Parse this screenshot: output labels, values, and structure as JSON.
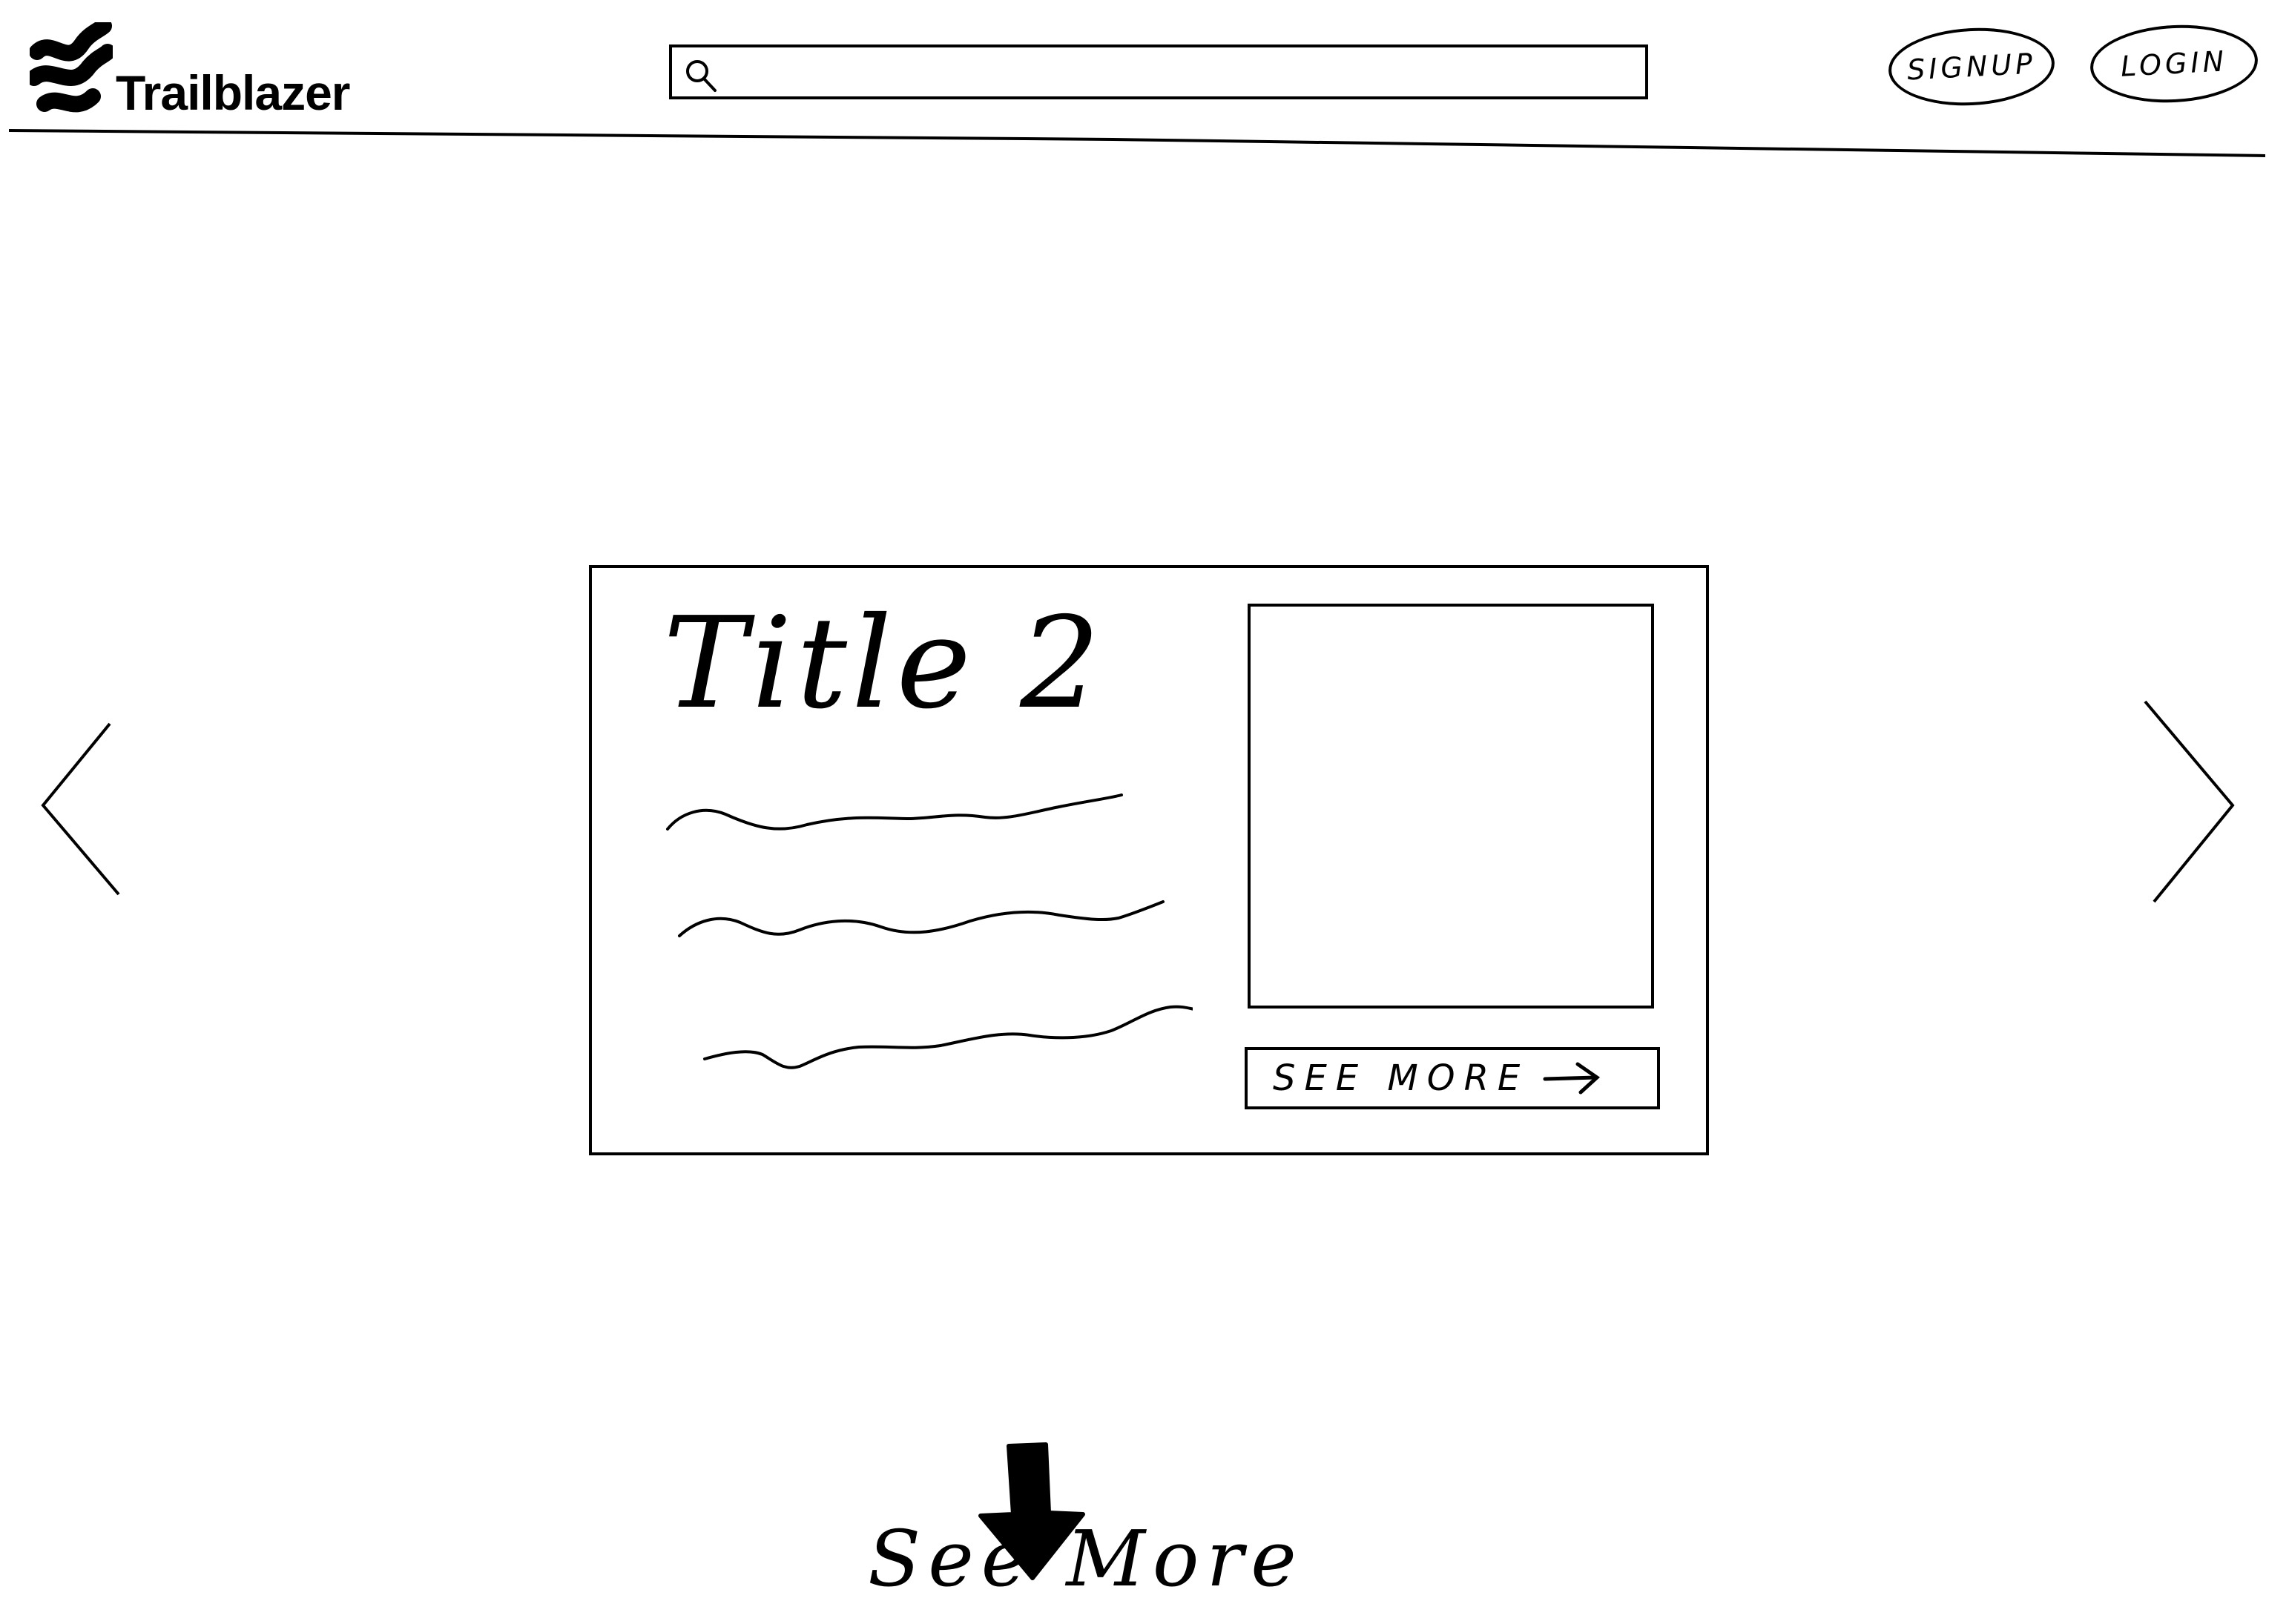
{
  "header": {
    "brand_name": "Trailblazer",
    "logo_icon": "trailblazer-logo-icon",
    "search": {
      "placeholder": "",
      "value": "",
      "icon": "search-icon"
    },
    "signup_label": "SIGNUP",
    "login_label": "LOGIN"
  },
  "carousel": {
    "prev_icon": "chevron-left-icon",
    "next_icon": "chevron-right-icon",
    "card": {
      "title": "Title 2",
      "text_placeholder_lines": 3,
      "image_placeholder": "image-placeholder",
      "see_more_label": "SEE MORE",
      "see_more_icon": "arrow-right-icon"
    }
  },
  "footer": {
    "see_more_label": "See More",
    "see_more_icon": "arrow-down-icon"
  },
  "colors": {
    "ink": "#000000",
    "background": "#ffffff"
  }
}
